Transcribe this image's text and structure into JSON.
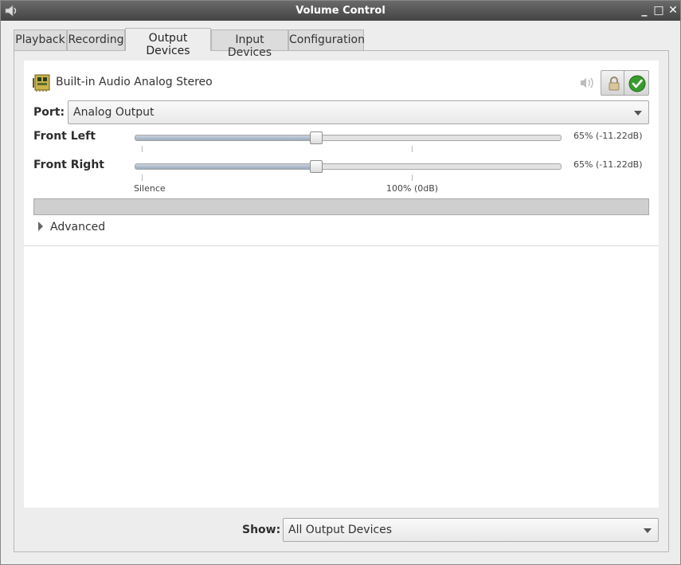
{
  "window": {
    "title": "Volume Control",
    "minimize_label": "_",
    "maximize_label": "□",
    "close_label": "✕"
  },
  "tabs": [
    {
      "label": "Playback"
    },
    {
      "label": "Recording"
    },
    {
      "label": "Output Devices"
    },
    {
      "label": "Input Devices"
    },
    {
      "label": "Configuration"
    }
  ],
  "active_tab": "Output Devices",
  "device": {
    "name": "Built-in Audio Analog Stereo",
    "icon": "sound-card-icon",
    "port_label": "Port:",
    "port_value": "Analog Output",
    "channels": [
      {
        "label": "Front Left",
        "value_text": "65% (-11.22dB)",
        "level": 0.65
      },
      {
        "label": "Front Right",
        "value_text": "65% (-11.22dB)",
        "level": 0.65
      }
    ],
    "marks": {
      "silence": "Silence",
      "full": "100% (0dB)"
    },
    "advanced_label": "Advanced"
  },
  "footer": {
    "show_label": "Show:",
    "show_value": "All Output Devices"
  },
  "colors": {
    "titlebar": "#4a4a4a",
    "accent_green": "#3a9a2e",
    "slider_fill": "#9aabbd"
  }
}
